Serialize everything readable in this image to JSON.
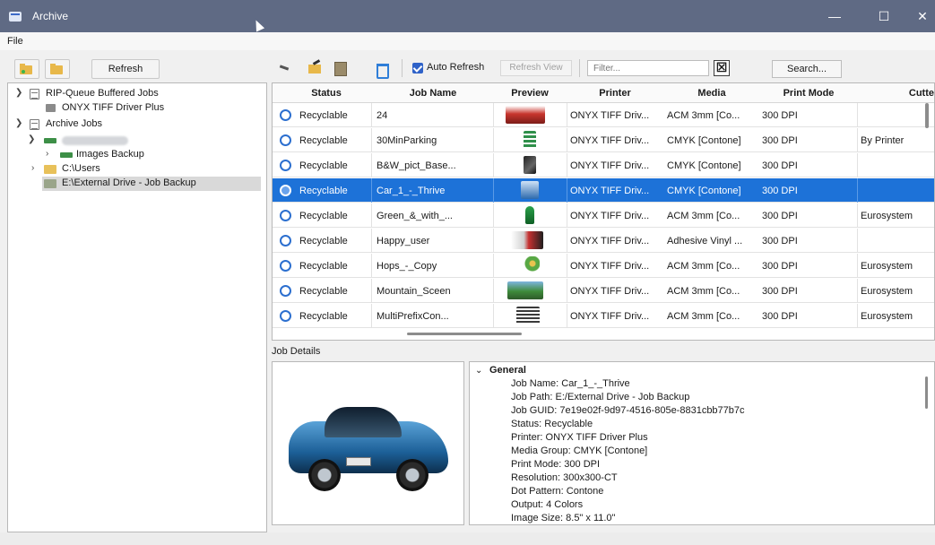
{
  "window": {
    "title": "Archive",
    "minimize": "—",
    "maximize": "☐",
    "close": "✕"
  },
  "menu": {
    "file": "File"
  },
  "left_toolbar": {
    "refresh_label": "Refresh"
  },
  "tree": {
    "items": [
      {
        "label": "RIP-Queue Buffered Jobs"
      },
      {
        "label": "ONYX TIFF Driver Plus"
      },
      {
        "label": "Archive Jobs"
      },
      {
        "label": "Images Backup"
      },
      {
        "label": "C:\\Users"
      },
      {
        "label": "E:\\External Drive - Job Backup"
      }
    ]
  },
  "right_toolbar": {
    "auto_refresh_label": "Auto Refresh",
    "refresh_view_label": "Refresh View",
    "filter_placeholder": "Filter...",
    "clear_label": "☒",
    "search_label": "Search..."
  },
  "grid": {
    "columns": [
      "Status",
      "Job Name",
      "Preview",
      "Printer",
      "Media",
      "Print Mode",
      "Cutte"
    ],
    "rows": [
      {
        "status": "Recyclable",
        "job": "24",
        "printer": "ONYX TIFF Driv...",
        "media": "ACM 3mm [Co...",
        "mode": "300 DPI",
        "cutter": ""
      },
      {
        "status": "Recyclable",
        "job": "30MinParking",
        "printer": "ONYX TIFF Driv...",
        "media": "CMYK [Contone]",
        "mode": "300 DPI",
        "cutter": "By Printer"
      },
      {
        "status": "Recyclable",
        "job": "B&W_pict_Base...",
        "printer": "ONYX TIFF Driv...",
        "media": "CMYK [Contone]",
        "mode": "300 DPI",
        "cutter": ""
      },
      {
        "status": "Recyclable",
        "job": "Car_1_-_Thrive",
        "printer": "ONYX TIFF Driv...",
        "media": "CMYK [Contone]",
        "mode": "300 DPI",
        "cutter": ""
      },
      {
        "status": "Recyclable",
        "job": "Green_&_with_...",
        "printer": "ONYX TIFF Driv...",
        "media": "ACM 3mm [Co...",
        "mode": "300 DPI",
        "cutter": "Eurosystem"
      },
      {
        "status": "Recyclable",
        "job": "Happy_user",
        "printer": "ONYX TIFF Driv...",
        "media": "Adhesive Vinyl ...",
        "mode": "300 DPI",
        "cutter": ""
      },
      {
        "status": "Recyclable",
        "job": "Hops_-_Copy",
        "printer": "ONYX TIFF Driv...",
        "media": "ACM 3mm [Co...",
        "mode": "300 DPI",
        "cutter": "Eurosystem"
      },
      {
        "status": "Recyclable",
        "job": "Mountain_Sceen",
        "printer": "ONYX TIFF Driv...",
        "media": "ACM 3mm [Co...",
        "mode": "300 DPI",
        "cutter": "Eurosystem"
      },
      {
        "status": "Recyclable",
        "job": "MultiPrefixCon...",
        "printer": "ONYX TIFF Driv...",
        "media": "ACM 3mm [Co...",
        "mode": "300 DPI",
        "cutter": "Eurosystem"
      }
    ]
  },
  "details": {
    "section_label": "Job Details",
    "group_label": "General",
    "lines": [
      "Job Name: Car_1_-_Thrive",
      "Job Path: E:/External Drive - Job Backup",
      "Job GUID: 7e19e02f-9d97-4516-805e-8831cbb77b7c",
      "Status: Recyclable",
      "Printer: ONYX TIFF Driver Plus",
      "Media Group: CMYK [Contone]",
      "Print Mode: 300 DPI",
      "Resolution: 300x300-CT",
      "Dot Pattern: Contone",
      "Output: 4 Colors",
      "Image Size: 8.5\" x 11.0\""
    ]
  },
  "colors": {
    "titlebar": "#5f6a84",
    "selection": "#1d72d8",
    "status_icon": "#2c6fcf"
  },
  "icons": [
    "app-icon",
    "add-folder-icon",
    "folder-icon",
    "back-icon",
    "open-icon",
    "properties-icon",
    "trash-icon",
    "checkbox-icon",
    "clear-icon",
    "status-icon",
    "chevron-icon"
  ]
}
